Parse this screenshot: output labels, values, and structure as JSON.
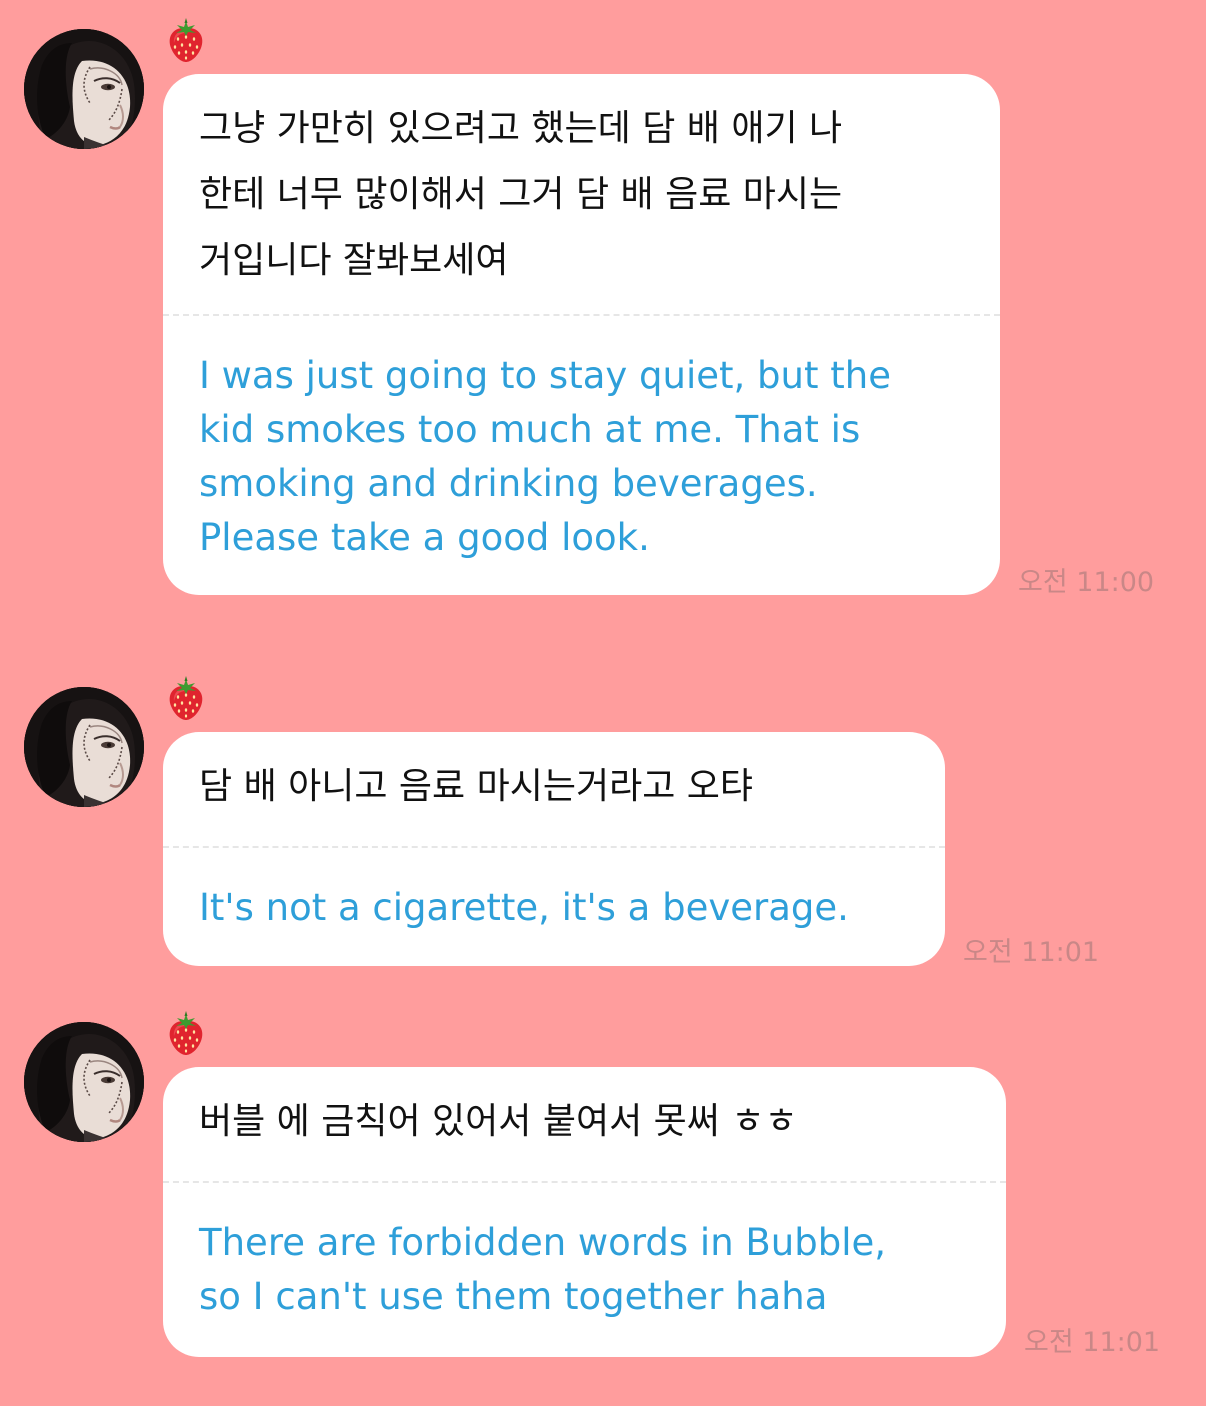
{
  "colors": {
    "background": "#FF9D9D",
    "bubble": "#FFFFFF",
    "original_text": "#111111",
    "translation_text": "#2E9FD9",
    "timestamp": "#C98787"
  },
  "messages": [
    {
      "sender_badge_icon": "strawberry-icon",
      "original": "그냥 가만히 있으려고 했는데 담 배 애기 나\n한테 너무 많이해서 그거 담 배 음료 마시는\n거입니다 잘봐보세여",
      "translation": "I was just going to stay quiet, but the\nkid smokes too much at me. That is\nsmoking and drinking beverages.\nPlease take a good look.",
      "time": "오전 11:00"
    },
    {
      "sender_badge_icon": "strawberry-icon",
      "original": "담 배 아니고 음료 마시는거라고 오탸",
      "translation": "It's not a cigarette, it's a beverage.",
      "time": "오전 11:01"
    },
    {
      "sender_badge_icon": "strawberry-icon",
      "original": "버블 에 금칙어 있어서 붙여서 못써 ㅎㅎ",
      "translation": "There are forbidden words in Bubble,\nso I can't use them together haha",
      "time": "오전 11:01"
    }
  ]
}
